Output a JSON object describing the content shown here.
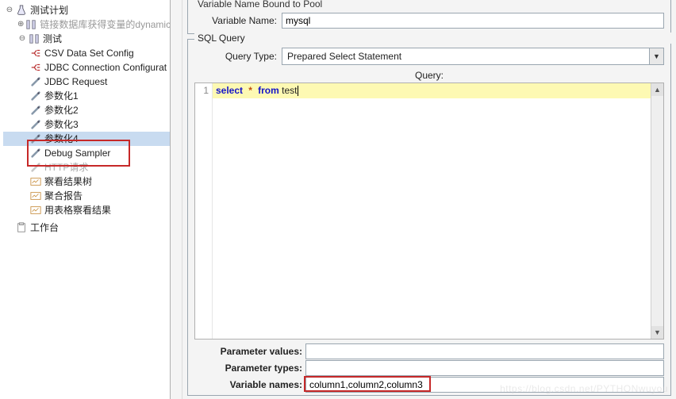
{
  "tree": {
    "root": "测试计划",
    "items": [
      "链接数据库获得变量的dynamic",
      "测试",
      "CSV Data Set Config",
      "JDBC Connection Configurat",
      "JDBC Request",
      "参数化1",
      "参数化2",
      "参数化3",
      "参数化4",
      "Debug Sampler",
      "HTTP请求",
      "察看结果树",
      "聚合报告",
      "用表格察看结果"
    ],
    "workbench": "工作台"
  },
  "pool": {
    "legend": "Variable Name Bound to Pool",
    "name_label": "Variable Name:",
    "name_value": "mysql"
  },
  "sql": {
    "legend": "SQL Query",
    "query_type_label": "Query Type:",
    "query_type_value": "Prepared Select Statement",
    "editor_label": "Query:",
    "gutter_1": "1",
    "code_kw1": "select",
    "code_op": "*",
    "code_kw2": "from",
    "code_txt": " test"
  },
  "bottom": {
    "param_values_lbl": "Parameter values:",
    "param_values_val": "",
    "param_types_lbl": "Parameter types:",
    "param_types_val": "",
    "var_names_lbl": "Variable names:",
    "var_names_val": "column1,column2,column3"
  },
  "watermark": "https://blog.csdn.net/PYTHONwuyou"
}
